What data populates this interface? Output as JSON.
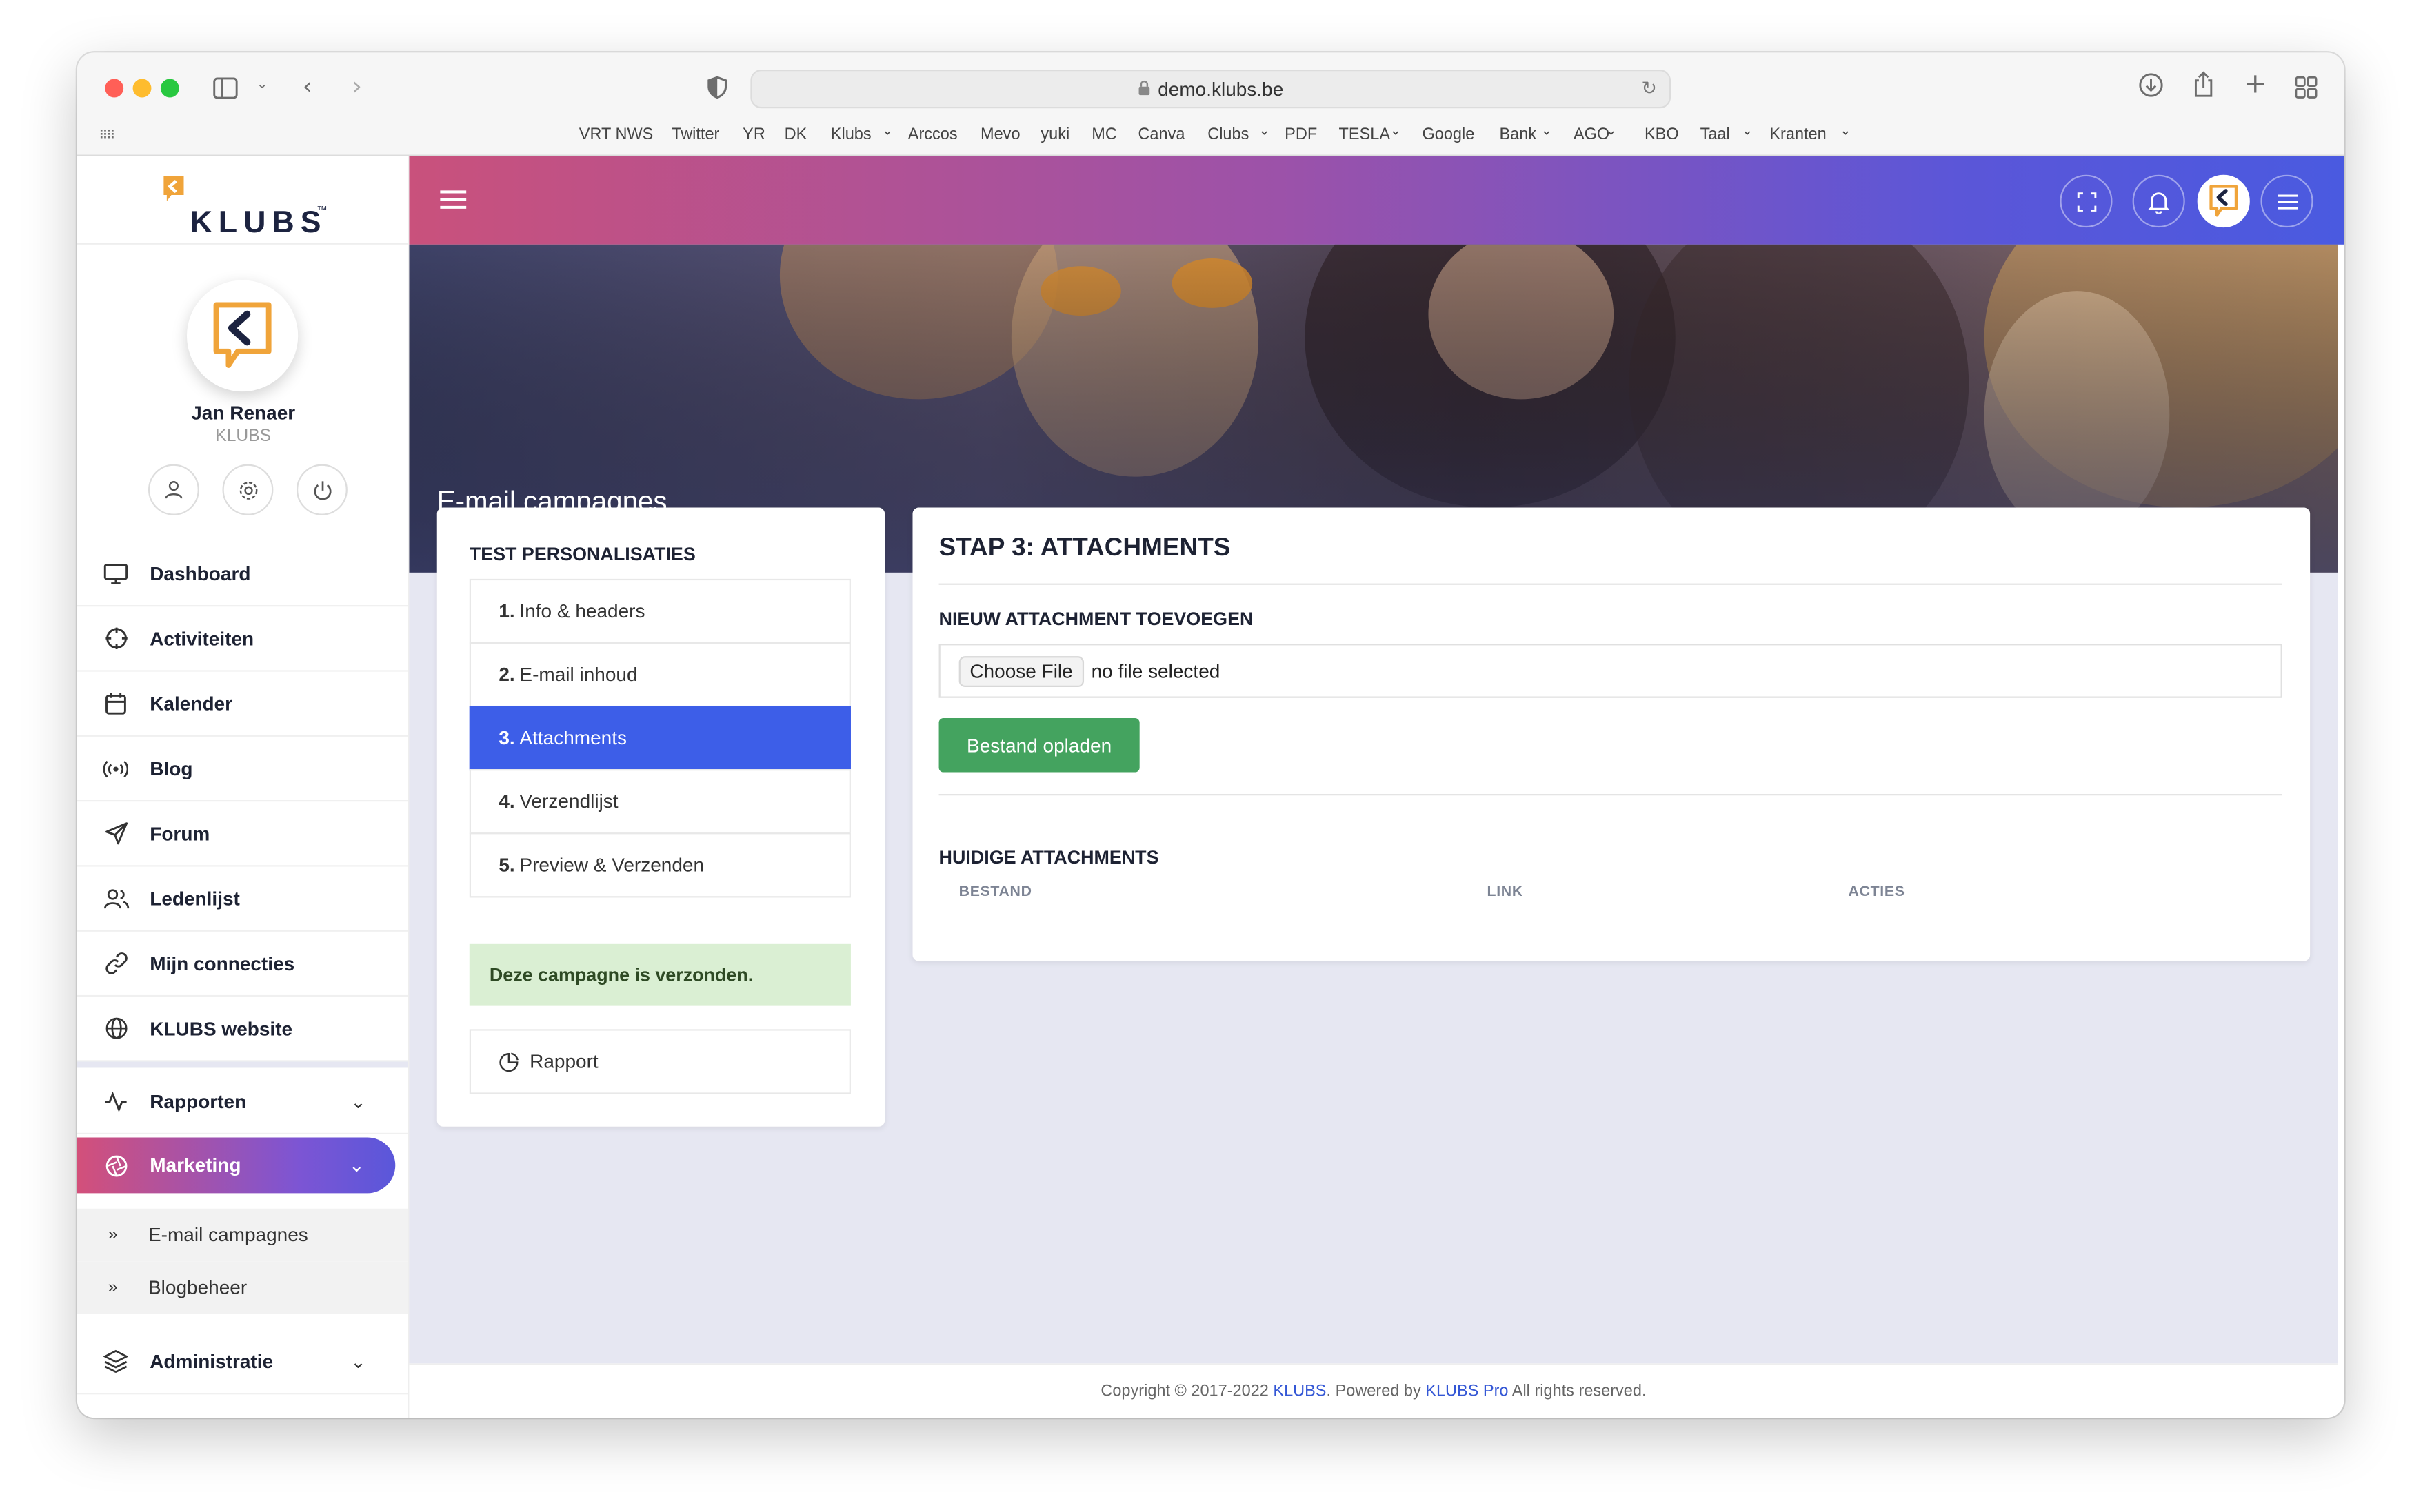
{
  "browser": {
    "url": "demo.klubs.be",
    "bookmarks": [
      "VRT NWS",
      "Twitter",
      "YR",
      "DK",
      "Klubs",
      "Arccos",
      "Mevo",
      "yuki",
      "MC",
      "Canva",
      "Clubs",
      "PDF",
      "TESLA",
      "Google",
      "Bank",
      "AGO",
      "KBO",
      "Taal",
      "Kranten"
    ],
    "colors": {
      "close": "#ff5f57",
      "minimize": "#febc2e",
      "maximize": "#28c840"
    }
  },
  "brand": {
    "name": "KLUBS",
    "tm": "™",
    "accent": "#f0a43a"
  },
  "user": {
    "name": "Jan Renaer",
    "org": "KLUBS"
  },
  "nav": {
    "items": [
      {
        "label": "Dashboard",
        "icon": "monitor-icon"
      },
      {
        "label": "Activiteiten",
        "icon": "crosshair-icon"
      },
      {
        "label": "Kalender",
        "icon": "calendar-icon"
      },
      {
        "label": "Blog",
        "icon": "broadcast-icon"
      },
      {
        "label": "Forum",
        "icon": "send-icon"
      },
      {
        "label": "Ledenlijst",
        "icon": "users-icon"
      },
      {
        "label": "Mijn connecties",
        "icon": "link-icon"
      },
      {
        "label": "KLUBS website",
        "icon": "globe-icon"
      }
    ],
    "rapporten": "Rapporten",
    "marketing": "Marketing",
    "marketing_sub": [
      "E-mail campagnes",
      "Blogbeheer"
    ],
    "administratie": "Administratie"
  },
  "page": {
    "title": "E-mail campagnes"
  },
  "steps_panel": {
    "title": "TEST PERSONALISATIES",
    "steps": [
      {
        "num": "1.",
        "label": "Info & headers"
      },
      {
        "num": "2.",
        "label": "E-mail inhoud"
      },
      {
        "num": "3.",
        "label": "Attachments"
      },
      {
        "num": "4.",
        "label": "Verzendlijst"
      },
      {
        "num": "5.",
        "label": "Preview & Verzenden"
      }
    ],
    "active_step": 3,
    "notice": "Deze campagne is verzonden.",
    "report_label": "Rapport"
  },
  "main": {
    "title": "STAP 3: ATTACHMENTS",
    "new_section": "NIEUW ATTACHMENT TOEVOEGEN",
    "choose_file": "Choose File",
    "no_file": "no file selected",
    "upload_button": "Bestand opladen",
    "current_section": "HUIDIGE ATTACHMENTS",
    "columns": [
      "BESTAND",
      "LINK",
      "ACTIES"
    ]
  },
  "footer": {
    "prefix": "Copyright © 2017-2022 ",
    "brand_link": "KLUBS",
    "middle": ". Powered by ",
    "pro_link": "KLUBS Pro",
    "suffix": " All rights reserved."
  }
}
